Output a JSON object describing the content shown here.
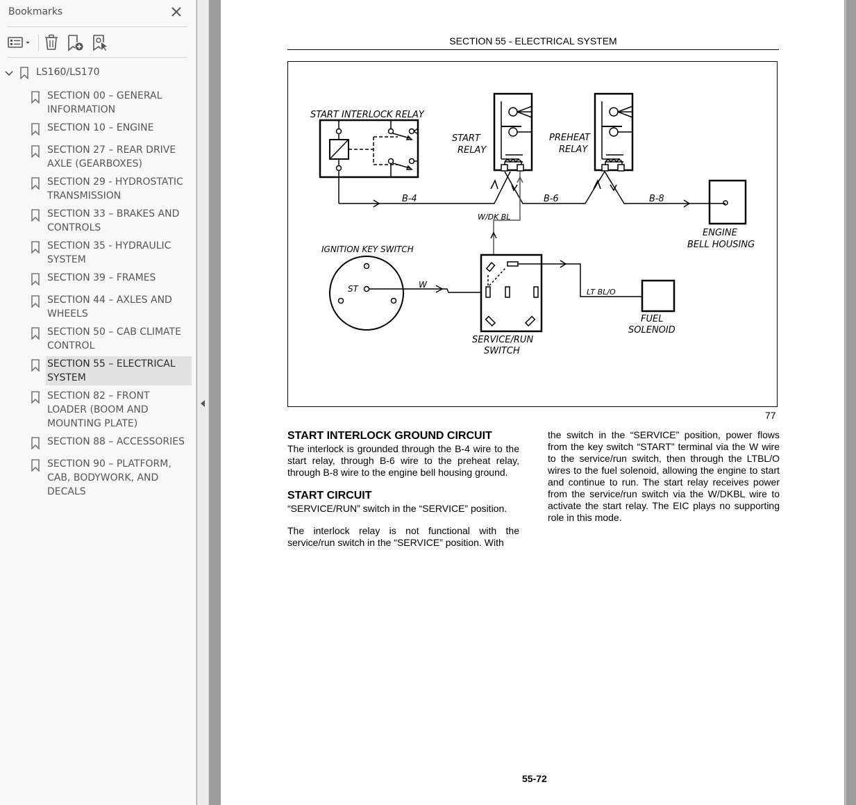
{
  "sidebar": {
    "title": "Bookmarks",
    "close_icon": "close-icon",
    "toolbar": {
      "options_icon": "bookmark-options-icon",
      "delete_icon": "trash-icon",
      "new_bookmark_icon": "new-bookmark-icon",
      "find_current_icon": "find-current-bookmark-icon"
    },
    "root": {
      "label": "LS160/LS170",
      "expanded": true
    },
    "items": [
      {
        "label": "SECTION 00 – GENERAL INFORMATION",
        "selected": false
      },
      {
        "label": "SECTION 10 – ENGINE",
        "selected": false
      },
      {
        "label": "SECTION 27 – REAR DRIVE AXLE (GEARBOXES)",
        "selected": false
      },
      {
        "label": "SECTION 29 - HYDROSTATIC TRANSMISSION",
        "selected": false
      },
      {
        "label": "SECTION 33 – BRAKES AND CONTROLS",
        "selected": false
      },
      {
        "label": "SECTION 35 - HYDRAULIC SYSTEM",
        "selected": false
      },
      {
        "label": "SECTION 39 – FRAMES",
        "selected": false
      },
      {
        "label": "SECTION 44 – AXLES AND WHEELS",
        "selected": false
      },
      {
        "label": "SECTION 50 – CAB CLIMATE CONTROL",
        "selected": false
      },
      {
        "label": "SECTION 55 – ELECTRICAL SYSTEM",
        "selected": true
      },
      {
        "label": "SECTION 82 – FRONT LOADER (BOOM AND MOUNTING PLATE)",
        "selected": false
      },
      {
        "label": "SECTION 88 – ACCESSORIES",
        "selected": false
      },
      {
        "label": "SECTION 90 – PLATFORM, CAB, BODYWORK, AND DECALS",
        "selected": false
      }
    ]
  },
  "page": {
    "header": "SECTION 55 - ELECTRICAL SYSTEM",
    "figure": {
      "number": "77",
      "labels": {
        "interlock_relay": "START INTERLOCK RELAY",
        "start_relay_1": "START",
        "start_relay_2": "RELAY",
        "preheat_relay_1": "PREHEAT",
        "preheat_relay_2": "RELAY",
        "wire_b4": "B-4",
        "wire_b6": "B-6",
        "wire_b8": "B-8",
        "wire_wdkbl": "W/DK BL",
        "engine_1": "ENGINE",
        "engine_2": "BELL HOUSING",
        "ignition": "IGNITION KEY SWITCH",
        "st": "ST",
        "wire_w": "W",
        "wire_ltblo": "LT BL/O",
        "fuel_1": "FUEL",
        "fuel_2": "SOLENOID",
        "service_1": "SERVICE/RUN",
        "service_2": "SWITCH"
      }
    },
    "left_column": {
      "heading1": "START INTERLOCK GROUND CIRCUIT",
      "para1": "The interlock is grounded through the B-4 wire to the start relay, through B-6 wire to the preheat relay, through B-8 wire to the engine bell housing ground.",
      "heading2": "START CIRCUIT",
      "para2": "“SERVICE/RUN” switch in the “SERVICE” position.",
      "para3": "The interlock relay is not functional with the service/run switch in the “SERVICE” position. With"
    },
    "right_column": {
      "para1": "the switch in the “SERVICE” position, power flows from the key switch “START” terminal via the W wire to the service/run switch, then through the LTBL/O wires to the fuel solenoid, allowing the engine to start and continue to run. The start relay receives power from the service/run switch via the W/DKBL wire to activate the start relay. The EIC plays no supporting role in this mode."
    },
    "page_number": "55-72"
  }
}
